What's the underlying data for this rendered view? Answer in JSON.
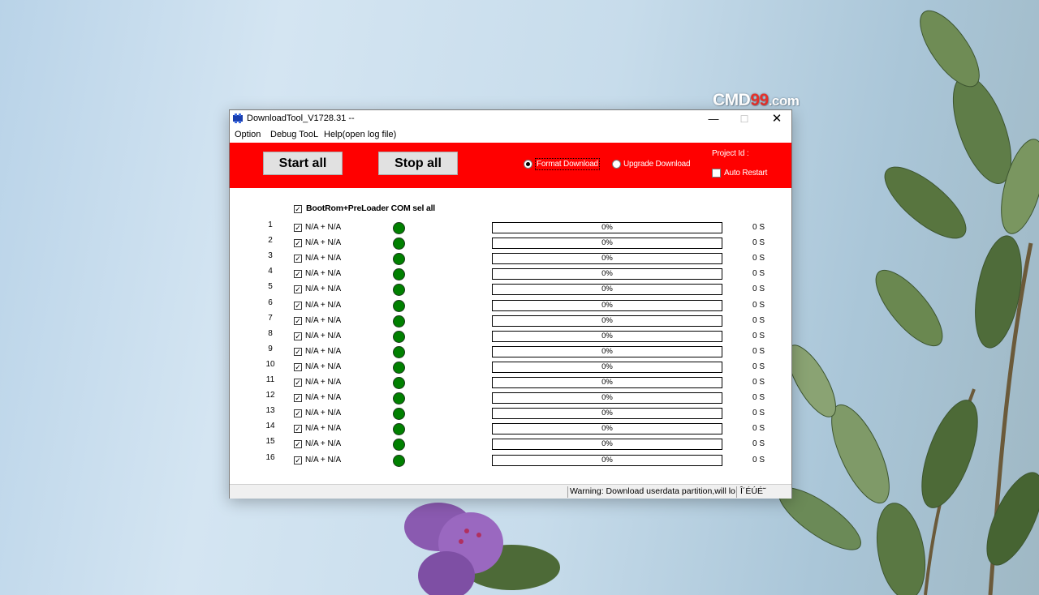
{
  "window": {
    "title": "DownloadTool_V1728.31 --",
    "controls": {
      "minimize": "—",
      "maximize": "☐",
      "close": "✕"
    }
  },
  "watermark": {
    "prefix": "CMD",
    "number": "99",
    "suffix": ".com"
  },
  "menu": [
    {
      "label": "Option"
    },
    {
      "label": "Debug TooL"
    },
    {
      "label": "Help(open log file)"
    }
  ],
  "toolbar": {
    "start_label": "Start all",
    "stop_label": "Stop all",
    "format_download_label": "Format Download",
    "upgrade_download_label": "Upgrade Download",
    "selected_mode": "Format Download",
    "project_id_label": "Project Id :",
    "auto_restart_label": "Auto Restart",
    "auto_restart_checked": false
  },
  "select_all": {
    "label": "BootRom+PreLoader COM sel all",
    "checked": true
  },
  "ports": [
    {
      "num": "1",
      "checked": true,
      "port": "N/A + N/A",
      "status": "green",
      "progress": 0,
      "progress_text": "0%",
      "time": "0 S"
    },
    {
      "num": "2",
      "checked": true,
      "port": "N/A + N/A",
      "status": "green",
      "progress": 0,
      "progress_text": "0%",
      "time": "0 S"
    },
    {
      "num": "3",
      "checked": true,
      "port": "N/A + N/A",
      "status": "green",
      "progress": 0,
      "progress_text": "0%",
      "time": "0 S"
    },
    {
      "num": "4",
      "checked": true,
      "port": "N/A + N/A",
      "status": "green",
      "progress": 0,
      "progress_text": "0%",
      "time": "0 S"
    },
    {
      "num": "5",
      "checked": true,
      "port": "N/A + N/A",
      "status": "green",
      "progress": 0,
      "progress_text": "0%",
      "time": "0 S"
    },
    {
      "num": "6",
      "checked": true,
      "port": "N/A + N/A",
      "status": "green",
      "progress": 0,
      "progress_text": "0%",
      "time": "0 S"
    },
    {
      "num": "7",
      "checked": true,
      "port": "N/A + N/A",
      "status": "green",
      "progress": 0,
      "progress_text": "0%",
      "time": "0 S"
    },
    {
      "num": "8",
      "checked": true,
      "port": "N/A + N/A",
      "status": "green",
      "progress": 0,
      "progress_text": "0%",
      "time": "0 S"
    },
    {
      "num": "9",
      "checked": true,
      "port": "N/A + N/A",
      "status": "green",
      "progress": 0,
      "progress_text": "0%",
      "time": "0 S"
    },
    {
      "num": "10",
      "checked": true,
      "port": "N/A + N/A",
      "status": "green",
      "progress": 0,
      "progress_text": "0%",
      "time": "0 S"
    },
    {
      "num": "11",
      "checked": true,
      "port": "N/A + N/A",
      "status": "green",
      "progress": 0,
      "progress_text": "0%",
      "time": "0 S"
    },
    {
      "num": "12",
      "checked": true,
      "port": "N/A + N/A",
      "status": "green",
      "progress": 0,
      "progress_text": "0%",
      "time": "0 S"
    },
    {
      "num": "13",
      "checked": true,
      "port": "N/A + N/A",
      "status": "green",
      "progress": 0,
      "progress_text": "0%",
      "time": "0 S"
    },
    {
      "num": "14",
      "checked": true,
      "port": "N/A + N/A",
      "status": "green",
      "progress": 0,
      "progress_text": "0%",
      "time": "0 S"
    },
    {
      "num": "15",
      "checked": true,
      "port": "N/A + N/A",
      "status": "green",
      "progress": 0,
      "progress_text": "0%",
      "time": "0 S"
    },
    {
      "num": "16",
      "checked": true,
      "port": "N/A + N/A",
      "status": "green",
      "progress": 0,
      "progress_text": "0%",
      "time": "0 S"
    }
  ],
  "statusbar": {
    "segment1": "",
    "warning": "Warning: Download userdata partition,will lo",
    "segment3": "Î´ÉÚÉ˜"
  },
  "colors": {
    "toolbar_bg": "#ff0000",
    "led_green": "#008000",
    "window_bg": "#ffffff"
  }
}
